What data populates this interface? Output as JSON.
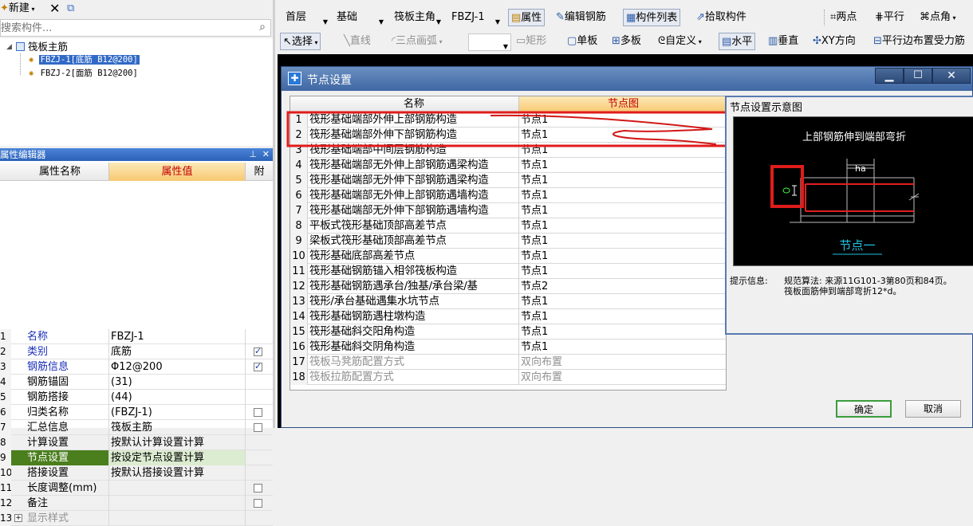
{
  "left_toolbar": {
    "new_label": "新建",
    "search_placeholder": "搜索构件..."
  },
  "tree": {
    "root": "筏板主筋",
    "items": [
      {
        "label": "FBZJ-1[底筋 B12@200]",
        "selected": true
      },
      {
        "label": "FBZJ-2[面筋 B12@200]",
        "selected": false
      }
    ]
  },
  "prop_editor": {
    "title": "属性编辑器",
    "col_name": "属性名称",
    "col_value": "属性值",
    "col_attach": "附",
    "rows": [
      {
        "no": "1",
        "name": "名称",
        "value": "FBZJ-1",
        "check": null,
        "blue": true
      },
      {
        "no": "2",
        "name": "类别",
        "value": "底筋",
        "check": true,
        "blue": true
      },
      {
        "no": "3",
        "name": "钢筋信息",
        "value": "Φ12@200",
        "check": true,
        "blue": true
      },
      {
        "no": "4",
        "name": "钢筋锚固",
        "value": "(31)",
        "check": null,
        "blue": false
      },
      {
        "no": "5",
        "name": "钢筋搭接",
        "value": "(44)",
        "check": null,
        "blue": false
      },
      {
        "no": "6",
        "name": "归类名称",
        "value": "(FBZJ-1)",
        "check": false,
        "blue": false
      },
      {
        "no": "7",
        "name": "汇总信息",
        "value": "筏板主筋",
        "check": false,
        "blue": false
      },
      {
        "no": "8",
        "name": "计算设置",
        "value": "按默认计算设置计算",
        "check": null,
        "blue": false
      },
      {
        "no": "9",
        "name": "节点设置",
        "value": "按设定节点设置计算",
        "check": null,
        "blue": false,
        "selected": true
      },
      {
        "no": "10",
        "name": "搭接设置",
        "value": "按默认搭接设置计算",
        "check": null,
        "blue": false
      },
      {
        "no": "11",
        "name": "长度调整(mm)",
        "value": "",
        "check": false,
        "blue": false
      },
      {
        "no": "12",
        "name": "备注",
        "value": "",
        "check": false,
        "blue": false
      },
      {
        "no": "13",
        "name": "显示样式",
        "value": "",
        "check": null,
        "blue": false,
        "gray": true
      }
    ]
  },
  "top_toolbar": {
    "floor": "首层",
    "category": "基础",
    "type": "筏板主角",
    "component": "FBZJ-1",
    "btn_props": "属性",
    "btn_edit_rebar": "编辑钢筋",
    "btn_component_list": "构件列表",
    "btn_pick": "拾取构件",
    "btn_two_point": "两点",
    "btn_parallel": "平行",
    "btn_point_angle": "点角"
  },
  "draw_toolbar": {
    "select": "选择",
    "line": "直线",
    "arc": "三点画弧",
    "rect": "矩形",
    "single_board": "单板",
    "multi_board": "多板",
    "custom": "自定义",
    "horizontal": "水平",
    "vertical": "垂直",
    "xy": "XY方向",
    "parallel_edge": "平行边布置受力筋"
  },
  "dialog": {
    "title": "节点设置",
    "col_name": "名称",
    "col_node": "节点图",
    "rows": [
      {
        "no": "1",
        "name": "筏形基础端部外伸上部钢筋构造",
        "node": "节点1"
      },
      {
        "no": "2",
        "name": "筏形基础端部外伸下部钢筋构造",
        "node": "节点1"
      },
      {
        "no": "3",
        "name": "筏形基础端部中间层钢筋构造",
        "node": "节点1"
      },
      {
        "no": "4",
        "name": "筏形基础端部无外伸上部钢筋遇梁构造",
        "node": "节点1"
      },
      {
        "no": "5",
        "name": "筏形基础端部无外伸下部钢筋遇梁构造",
        "node": "节点1"
      },
      {
        "no": "6",
        "name": "筏形基础端部无外伸上部钢筋遇墙构造",
        "node": "节点1"
      },
      {
        "no": "7",
        "name": "筏形基础端部无外伸下部钢筋遇墙构造",
        "node": "节点1"
      },
      {
        "no": "8",
        "name": "平板式筏形基础顶部高差节点",
        "node": "节点1"
      },
      {
        "no": "9",
        "name": "梁板式筏形基础顶部高差节点",
        "node": "节点1"
      },
      {
        "no": "10",
        "name": "筏形基础底部高差节点",
        "node": "节点1"
      },
      {
        "no": "11",
        "name": "筏形基础钢筋锚入相邻筏板构造",
        "node": "节点1"
      },
      {
        "no": "12",
        "name": "筏形基础钢筋遇承台/独基/承台梁/基",
        "node": "节点2"
      },
      {
        "no": "13",
        "name": "筏形/承台基础遇集水坑节点",
        "node": "节点1"
      },
      {
        "no": "14",
        "name": "筏形基础钢筋遇柱墩构造",
        "node": "节点1"
      },
      {
        "no": "15",
        "name": "筏形基础斜交阳角构造",
        "node": "节点1"
      },
      {
        "no": "16",
        "name": "筏形基础斜交阴角构造",
        "node": "节点1"
      },
      {
        "no": "17",
        "name": "筏板马凳筋配置方式",
        "node": "双向布置",
        "gray": true
      },
      {
        "no": "18",
        "name": "筏板拉筋配置方式",
        "node": "双向布置",
        "gray": true
      }
    ],
    "preview_title": "节点设置示意图",
    "diagram_caption": "上部钢筋伸到端部弯折",
    "diagram_ha": "ha",
    "diagram_node_label": "节点一",
    "hint_label": "提示信息:",
    "hint_line1": "规范算法: 来源11G101-3第80页和84页。",
    "hint_line2": "筏板面筋伸到端部弯折12*d。",
    "ok": "确定",
    "cancel": "取消"
  }
}
